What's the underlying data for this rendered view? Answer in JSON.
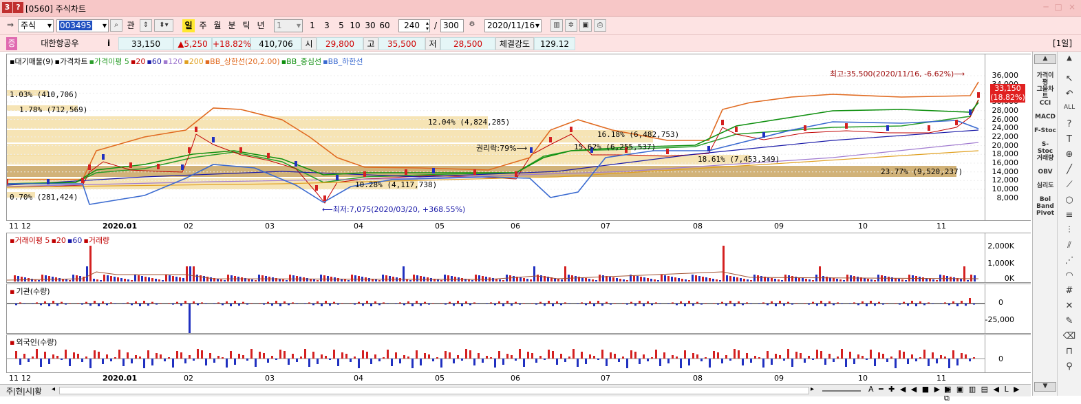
{
  "window": {
    "badge1": "3",
    "badge2": "?",
    "title": "[0560] 주식차트",
    "controls": [
      "─",
      "□",
      "×"
    ]
  },
  "toolbar": {
    "market": "주식",
    "code": "003495",
    "btn_gwan": "관",
    "periods": [
      "일",
      "주",
      "월",
      "분",
      "틱",
      "년"
    ],
    "interval": "1",
    "interval_opts": [
      "1",
      "3",
      "5",
      "10",
      "30",
      "60"
    ],
    "count": "240",
    "total": "300",
    "slash": "/",
    "date": "2020/11/16"
  },
  "quote": {
    "tag": "증",
    "name": "대한항공우",
    "info": "i",
    "price": "33,150",
    "change": "▲5,250",
    "rate": "+18.82%",
    "volume": "410,706",
    "open_label": "시",
    "open": "29,800",
    "high_label": "고",
    "high": "35,500",
    "low_label": "저",
    "low": "28,500",
    "strength_label": "체결강도",
    "strength": "129.12",
    "period_label": "[1일]"
  },
  "price_panel": {
    "legend": [
      {
        "text": "대기매물(9)",
        "color": "#000000"
      },
      {
        "text": "가격차트",
        "color": "#000000"
      },
      {
        "text": "가격이평 5",
        "color": "#2a9d2a"
      },
      {
        "text": "20",
        "color": "#c00000"
      },
      {
        "text": "60",
        "color": "#1a1aa8"
      },
      {
        "text": "120",
        "color": "#a07ad0"
      },
      {
        "text": "200",
        "color": "#e0a020"
      },
      {
        "text": "BB_상한선(20,2.00)",
        "color": "#e06a20"
      },
      {
        "text": "BB_중심선",
        "color": "#109010"
      },
      {
        "text": "BB_하한선",
        "color": "#3a6ad0"
      }
    ],
    "y_ticks": [
      "36,000",
      "34,000",
      "32,000",
      "30,000",
      "28,000",
      "26,000",
      "24,000",
      "22,000",
      "20,000",
      "18,000",
      "16,000",
      "14,000",
      "12,000",
      "10,000",
      "8,000"
    ],
    "y_values": [
      36000,
      34000,
      32000,
      30000,
      28000,
      26000,
      24000,
      22000,
      20000,
      18000,
      16000,
      14000,
      12000,
      10000,
      8000
    ],
    "current_price": "33,150",
    "current_rate": "(18.82%)",
    "high_note": "최고:35,500(2020/11/16, -6.62%)⟶",
    "low_note": "⟵최저:7,075(2020/03/20, +368.55%)",
    "rights_note": "권리락:79%⟶",
    "volume_profile": [
      {
        "label": "1.03% (410,706)",
        "pct": 1.03
      },
      {
        "label": "1.78% (712,569)",
        "pct": 1.78
      },
      {
        "label": "12.04% (4,824,285)",
        "pct": 12.04
      },
      {
        "label": "16.18% (6,482,753)",
        "pct": 16.18
      },
      {
        "label": "15.62% (6,255,537)",
        "pct": 15.62
      },
      {
        "label": "18.61% (7,453,349)",
        "pct": 18.61
      },
      {
        "label": "23.77% (9,520,237)",
        "pct": 23.77
      },
      {
        "label": "10.28% (4,117,738)",
        "pct": 10.28
      },
      {
        "label": "0.70% (281,424)",
        "pct": 0.7
      }
    ]
  },
  "x_labels": [
    "11",
    "12",
    "2020.01",
    "02",
    "03",
    "04",
    "05",
    "06",
    "07",
    "08",
    "09",
    "10",
    "11"
  ],
  "volume_panel": {
    "legend": [
      {
        "text": "거래이평 5",
        "color": "#c00000"
      },
      {
        "text": "20",
        "color": "#c00000"
      },
      {
        "text": "60",
        "color": "#1a1aa8"
      },
      {
        "text": "거래량",
        "color": "#c00000"
      }
    ],
    "y_ticks": [
      "2,000K",
      "1,000K",
      "0K"
    ]
  },
  "inst_panel": {
    "legend": "기관(수량)",
    "y_ticks": [
      "0",
      "-25,000"
    ]
  },
  "foreign_panel": {
    "legend": "외국인(수량)",
    "y_ticks": [
      "0"
    ]
  },
  "indicators": [
    "가격이평",
    "그물차트",
    "CCI",
    "MACD",
    "F-Stoc",
    "S-Stoc",
    "거래량",
    "OBV",
    "심리도",
    "Bol Band",
    "Pivot"
  ],
  "bottom_tabs": [
    "주",
    "현",
    "시",
    "황"
  ],
  "colors": {
    "up": "#d42020",
    "down": "#2030c0",
    "title_bg": "#f7c7c7",
    "toolbar_bg": "#fde3e3"
  }
}
